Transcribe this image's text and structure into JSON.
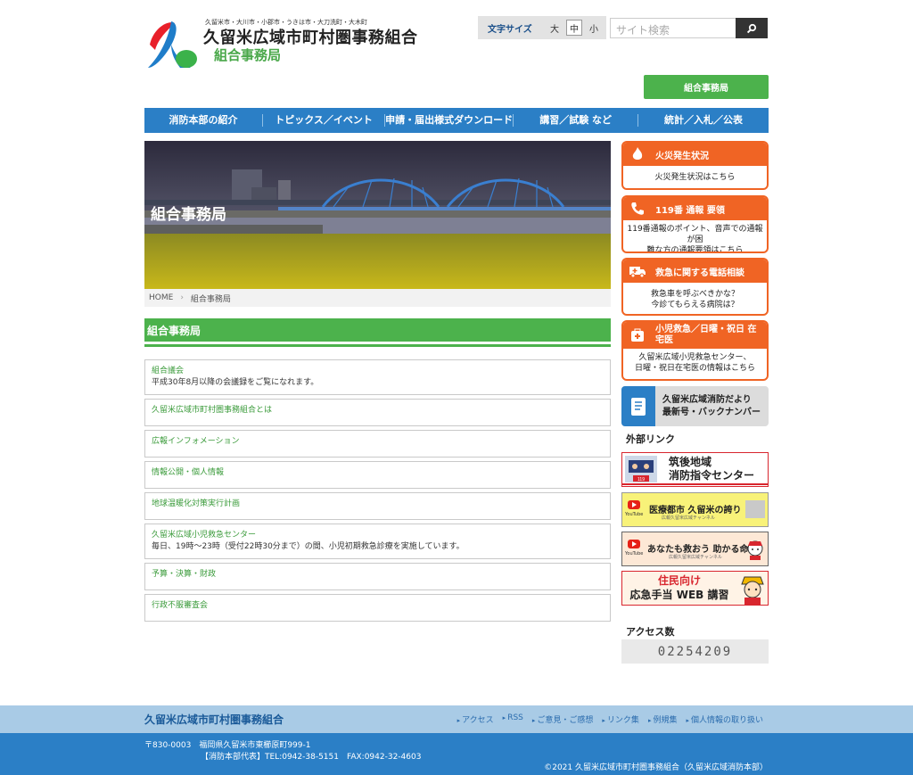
{
  "header": {
    "cities": "久留米市・大川市・小郡市・うきは市・大刀洗町・大木町",
    "org_name": "久留米広域市町村圏事務組合",
    "office_name": "組合事務局",
    "font_size_label": "文字サイズ",
    "font_sizes": [
      "大",
      "中",
      "小"
    ],
    "search_placeholder": "サイト検索",
    "office_button": "組合事務局"
  },
  "nav": [
    "消防本部の紹介",
    "トピックス／イベント",
    "申請・届出様式ダウンロード",
    "講習／試験 など",
    "統計／入札／公表"
  ],
  "hero": {
    "title": "組合事務局"
  },
  "breadcrumb": {
    "home": "HOME",
    "current": "組合事務局"
  },
  "section": {
    "title": "組合事務局",
    "items": [
      {
        "title": "組合議会",
        "desc": "平成30年8月以降の会議録をご覧になれます。"
      },
      {
        "title": "久留米広域市町村圏事務組合とは",
        "desc": ""
      },
      {
        "title": "広報インフォメーション",
        "desc": ""
      },
      {
        "title": "情報公開・個人情報",
        "desc": ""
      },
      {
        "title": "地球温暖化対策実行計画",
        "desc": ""
      },
      {
        "title": "久留米広域小児救急センター",
        "desc": "毎日、19時～23時（受付22時30分まで）の間、小児初期救急診療を実施しています。"
      },
      {
        "title": "予算・決算・財政",
        "desc": ""
      },
      {
        "title": "行政不服審査会",
        "desc": ""
      }
    ]
  },
  "sidebar": {
    "emergency": [
      {
        "title": "火災発生状況",
        "line1": "火災発生状況はこちら",
        "line2": "",
        "icon": "flame-icon"
      },
      {
        "title": "119番 通報 要領",
        "line1": "119番通報のポイント、音声での通報が困",
        "line2": "難な方の通報要領はこちら",
        "icon": "phone-icon"
      },
      {
        "title": "救急に関する電話相談",
        "line1": "救急車を呼ぶべきかな？",
        "line2": "今診てもらえる病院は？",
        "icon": "ambulance-icon"
      },
      {
        "title": "小児救急／日曜・祝日 在宅医",
        "line1": "久留米広域小児救急センター、",
        "line2": "日曜・祝日在宅医の情報はこちら",
        "icon": "first-aid-icon"
      }
    ],
    "newsletter": {
      "line1": "久留米広域消防だより",
      "line2": "最新号・バックナンバー"
    },
    "external_links_heading": "外部リンク",
    "banners": {
      "chikugo_line1": "筑後地域",
      "chikugo_line2": "消防指令センター",
      "chikugo_badge": "119",
      "youtube_logo": "YouTube",
      "medical_title": "医療都市 久留米の誇り",
      "medical_sub": "広報久留米広域チャンネル",
      "save_title": "あなたも救おう 助かる命",
      "save_sub": "広報久留米広域チャンネル",
      "web_line1": "住民向け",
      "web_line2": "応急手当 WEB 講習"
    },
    "access_heading": "アクセス数",
    "access_count": "02254209"
  },
  "footer": {
    "org_name": "久留米広域市町村圏事務組合",
    "links": [
      "アクセス",
      "RSS",
      "ご意見・ご感想",
      "リンク集",
      "例規集",
      "個人情報の取り扱い"
    ],
    "address": "〒830-0003　福岡県久留米市東櫛原町999-1",
    "contact": "【消防本部代表】TEL:0942-38-5151　FAX:0942-32-4603",
    "copyright": "©2021 久留米広域市町村圏事務組合（久留米広域消防本部）"
  },
  "colors": {
    "brand_blue": "#2b7fc6",
    "brand_green": "#4cb24c",
    "emergency_orange": "#f06424"
  }
}
